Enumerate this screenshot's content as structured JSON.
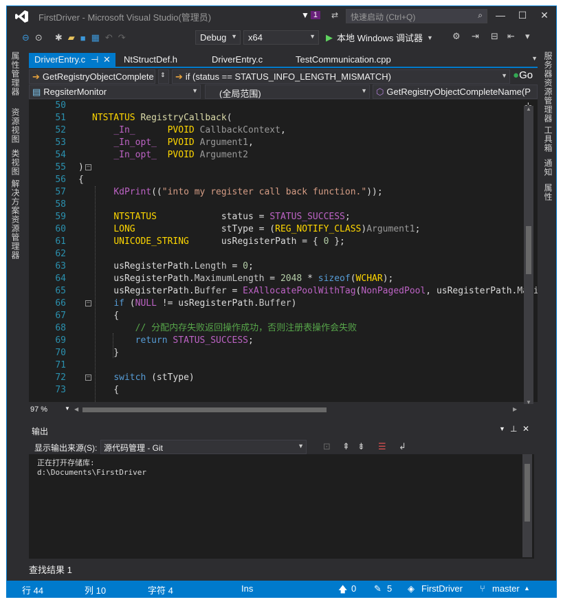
{
  "window": {
    "title": "FirstDriver - Microsoft Visual Studio(管理员)",
    "notify_count": "1",
    "quick_launch_placeholder": "快速启动 (Ctrl+Q)"
  },
  "toolbar": {
    "config": "Debug",
    "platform": "x64",
    "run_label": "本地 Windows 调试器"
  },
  "left_panels": [
    "属性管理器",
    "资源视图",
    "类视图",
    "解决方案资源管理器"
  ],
  "right_panels": [
    "服务器资源管理器",
    "工具箱",
    "通知",
    "属性"
  ],
  "tabs": [
    {
      "label": "DriverEntry.c",
      "pin": "⊣",
      "close": "✕",
      "active": true
    },
    {
      "label": "NtStructDef.h",
      "active": false
    },
    {
      "label": "DriverEntry.c",
      "active": false
    },
    {
      "label": "TestCommunication.cpp",
      "active": false
    }
  ],
  "nav": {
    "first": "GetRegistryObjectComplete",
    "second": "if (status == STATUS_INFO_LENGTH_MISMATCH)",
    "go": "Go",
    "project": "RegsiterMonitor",
    "scope": "(全局范围)",
    "member": "GetRegistryObjectCompleteName(P"
  },
  "code_lines": [
    {
      "n": "50",
      "t": ""
    },
    {
      "n": "51",
      "t": "NTSTATUS RegistryCallback("
    },
    {
      "n": "52",
      "t": "    _In_      PVOID CallbackContext,"
    },
    {
      "n": "53",
      "t": "    _In_opt_  PVOID Argument1,"
    },
    {
      "n": "54",
      "t": "    _In_opt_  PVOID Argument2"
    },
    {
      "n": "55",
      "t": ")"
    },
    {
      "n": "56",
      "t": "{"
    },
    {
      "n": "57",
      "t": "    KdPrint((\"into my register call back function.\"));"
    },
    {
      "n": "58",
      "t": ""
    },
    {
      "n": "59",
      "t": "    NTSTATUS            status = STATUS_SUCCESS;"
    },
    {
      "n": "60",
      "t": "    LONG                stType = (REG_NOTIFY_CLASS)Argument1;"
    },
    {
      "n": "61",
      "t": "    UNICODE_STRING      usRegisterPath = { 0 };"
    },
    {
      "n": "62",
      "t": ""
    },
    {
      "n": "63",
      "t": "    usRegisterPath.Length = 0;"
    },
    {
      "n": "64",
      "t": "    usRegisterPath.MaximumLength = 2048 * sizeof(WCHAR);"
    },
    {
      "n": "65",
      "t": "    usRegisterPath.Buffer = ExAllocatePoolWithTag(NonPagedPool, usRegisterPath.Maxi"
    },
    {
      "n": "66",
      "t": "    if (NULL != usRegisterPath.Buffer)"
    },
    {
      "n": "67",
      "t": "    {"
    },
    {
      "n": "68",
      "t": "        // 分配内存失败返回操作成功，否则注册表操作会失败"
    },
    {
      "n": "69",
      "t": "        return STATUS_SUCCESS;"
    },
    {
      "n": "70",
      "t": "    }"
    },
    {
      "n": "71",
      "t": ""
    },
    {
      "n": "72",
      "t": "    switch (stType)"
    },
    {
      "n": "73",
      "t": "    {"
    }
  ],
  "zoom": "97 %",
  "output": {
    "title": "输出",
    "source_label": "显示输出来源(S):",
    "source_value": "源代码管理 - Git",
    "lines": [
      "正在打开存储库:",
      "d:\\Documents\\FirstDriver"
    ]
  },
  "find_tab": "查找结果 1",
  "status": {
    "line": "行 44",
    "col": "列 10",
    "char": "字符 4",
    "ins": "Ins",
    "up": "0",
    "edits": "5",
    "repo": "FirstDriver",
    "branch": "master"
  },
  "colors": {
    "accent": "#007acc",
    "bg": "#2d2d30",
    "editor": "#1e1e1e"
  }
}
